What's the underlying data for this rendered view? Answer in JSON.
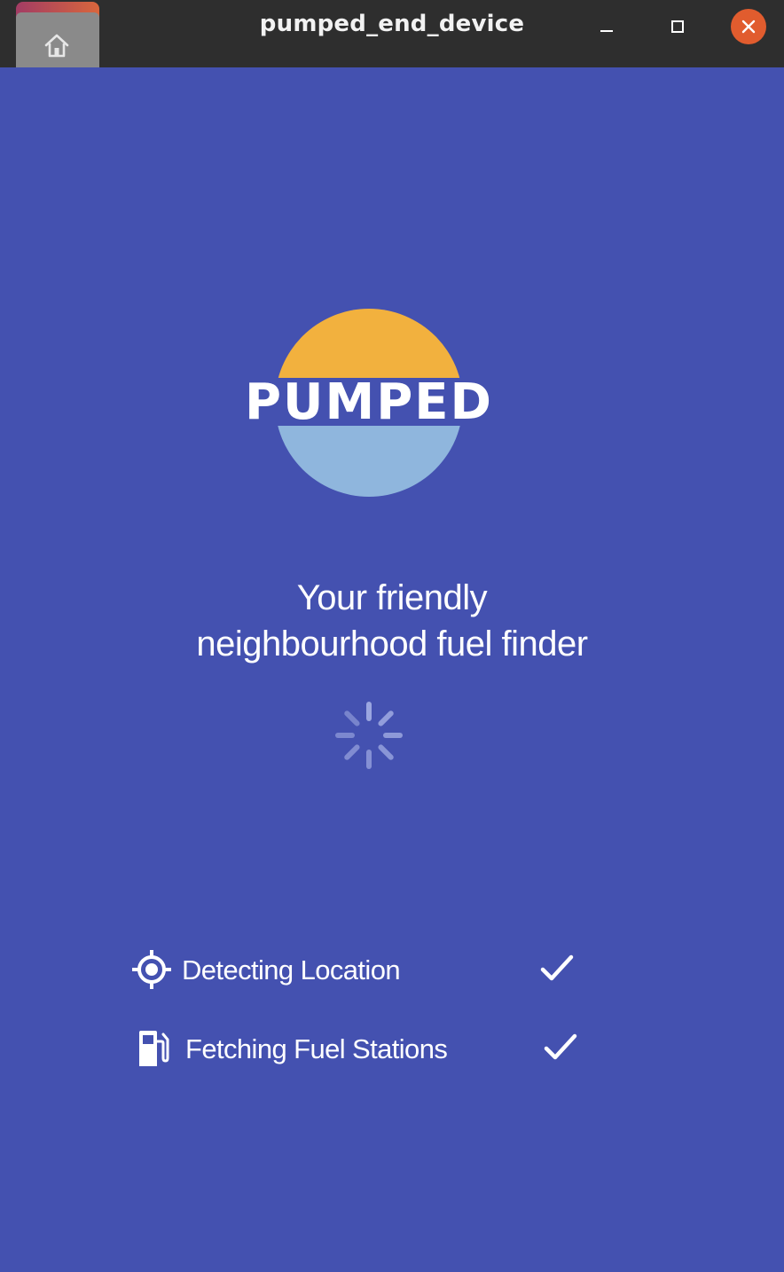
{
  "window": {
    "title": "pumped_end_device",
    "background": "#4451b0",
    "titlebar_color": "#2e2e2e",
    "close_button_color": "#e15c2e"
  },
  "icons": {
    "home": "home-folder-icon",
    "minimize": "minimize-icon",
    "maximize": "maximize-icon",
    "close": "close-icon",
    "spinner": "loading-spinner-icon",
    "location": "location-target-icon",
    "fuel": "fuel-pump-icon",
    "check": "checkmark-icon"
  },
  "logo": {
    "text": "PUMPED",
    "sun_color": "#f2b13e",
    "water_color": "#8fb6dd"
  },
  "tagline": {
    "line1": "Your friendly",
    "line2": "neighbourhood fuel finder"
  },
  "status": [
    {
      "label": "Detecting Location",
      "done": true
    },
    {
      "label": "Fetching Fuel Stations",
      "done": true
    }
  ]
}
